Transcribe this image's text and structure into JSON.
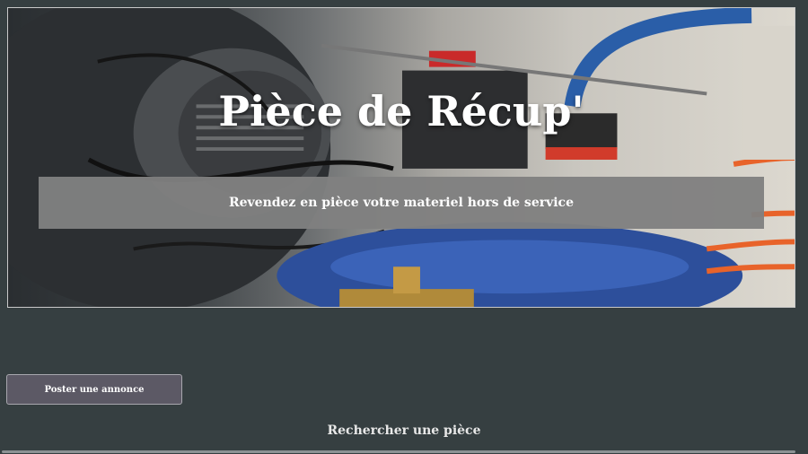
{
  "hero": {
    "title": "Pièce de Récup'",
    "tagline": "Revendez en pièce votre materiel hors de service"
  },
  "actions": {
    "post_ad_label": "Poster une annonce"
  },
  "search": {
    "heading": "Rechercher une pièce"
  },
  "colors": {
    "page_background": "#363f41",
    "tagline_box": "#808080",
    "button_background": "#5c5965"
  }
}
